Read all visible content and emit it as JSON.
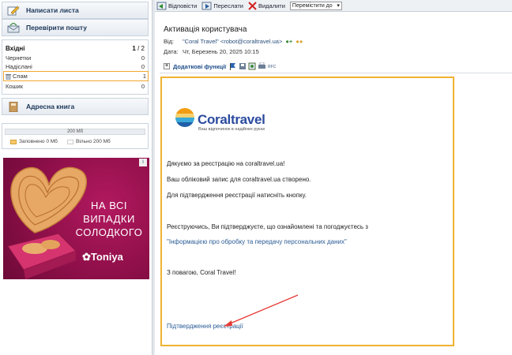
{
  "sidebar": {
    "compose_label": "Написати листа",
    "check_mail_label": "Перевірити пошту",
    "folders_header": "Вхідні",
    "folders_header_count": "1",
    "folders_header_total": "/ 2",
    "folders": [
      {
        "name": "Чернетки",
        "count": "0"
      },
      {
        "name": "Надіслані",
        "count": "0"
      },
      {
        "name": "Спам",
        "count": "1"
      },
      {
        "name": "Кошик",
        "count": "0"
      }
    ],
    "address_book_label": "Адресна книга",
    "quota": {
      "total": "200 Мб",
      "used_label": "Заповнено 0 Мб",
      "free_label": "Вільно 200 Мб",
      "used_color": "#f7c86a",
      "free_color": "#ffffff"
    }
  },
  "ad": {
    "text_line1": "НА ВСІ",
    "text_line2": "ВИПАДКИ",
    "text_line3": "СОЛОДКОГО",
    "brand": "Toniya",
    "info": "i"
  },
  "toolbar": {
    "reply_label": "Відповісти",
    "forward_label": "Переслати",
    "delete_label": "Видалити",
    "move_select": "Перемістити до"
  },
  "message": {
    "subject": "Активація користувача",
    "from_label": "Від:",
    "from_value": "\"Coral Travel\" <robot@coraltravel.ua>",
    "date_label": "Дата:",
    "date_value": "Чт, Березень 20, 2025 10:15",
    "extra_functions": "Додаткові функції",
    "body": {
      "logo_name": "Coraltravel",
      "logo_tagline": "Ваш відпочинок в надійних руках",
      "line1": "Дякуємо за реєстрацію на coraltravel.ua!",
      "line2": "Ваш обліковий запис для coraltravel.ua створено.",
      "line3": "Для підтвердження реєстрації натисніть кнопку.",
      "line4": "Реєструючись, Ви підтверджуєте, що ознайомлені та погоджуєтесь з",
      "policy_link": "\"Інформацією про обробку та передачу персональних даних\"",
      "signature": "З повагою, Coral Travel!",
      "confirm_link": "Підтвердження реєстрації"
    }
  },
  "colors": {
    "highlight": "#f0b232",
    "arrow": "#e53935",
    "link": "#2a5b95"
  }
}
